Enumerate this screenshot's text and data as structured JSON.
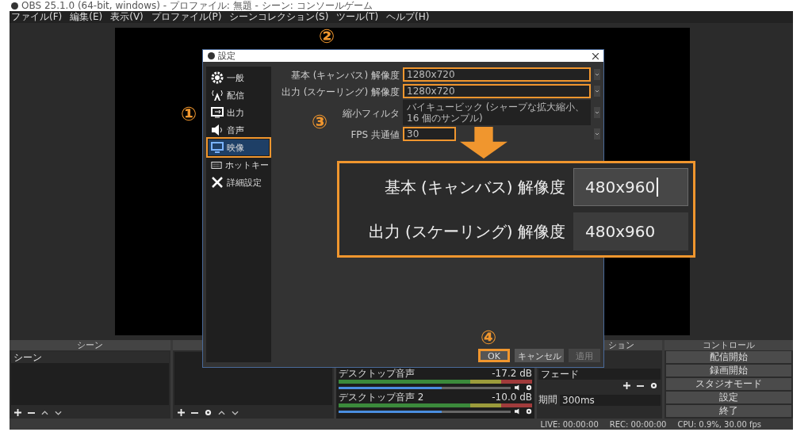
{
  "window": {
    "title": "OBS 25.1.0 (64-bit, windows) - プロファイル: 無題 - シーン: コンソールゲーム"
  },
  "menu": [
    "ファイル(F)",
    "編集(E)",
    "表示(V)",
    "プロファイル(P)",
    "シーンコレクション(S)",
    "ツール(T)",
    "ヘルプ(H)"
  ],
  "settings_dialog": {
    "title": "設定",
    "sidebar": [
      {
        "label": "一般",
        "selected": false,
        "highlighted": false
      },
      {
        "label": "配信",
        "selected": false,
        "highlighted": false
      },
      {
        "label": "出力",
        "selected": false,
        "highlighted": false
      },
      {
        "label": "音声",
        "selected": false,
        "highlighted": false
      },
      {
        "label": "映像",
        "selected": true,
        "highlighted": true
      },
      {
        "label": "ホットキー",
        "selected": false,
        "highlighted": false
      },
      {
        "label": "詳細設定",
        "selected": false,
        "highlighted": false
      }
    ],
    "fields": [
      {
        "label": "基本 (キャンバス) 解像度",
        "value": "1280x720",
        "highlighted": true
      },
      {
        "label": "出力 (スケーリング) 解像度",
        "value": "1280x720",
        "highlighted": true
      },
      {
        "label": "縮小フィルタ",
        "value": "バイキュービック (シャープな拡大縮小、16 個のサンプル)",
        "highlighted": false
      },
      {
        "label": "FPS 共通値",
        "value": "30",
        "highlighted": true
      }
    ],
    "buttons": [
      {
        "label": "OK",
        "highlighted": true,
        "disabled": false
      },
      {
        "label": "キャンセル",
        "highlighted": false,
        "disabled": false
      },
      {
        "label": "適用",
        "highlighted": false,
        "disabled": true
      }
    ]
  },
  "callout": {
    "rows": [
      {
        "label": "基本 (キャンバス) 解像度",
        "value": "480x960",
        "focused": true
      },
      {
        "label": "出力 (スケーリング) 解像度",
        "value": "480x960",
        "focused": false
      }
    ]
  },
  "step_markers": [
    "①",
    "②",
    "③",
    "④"
  ],
  "scenes": {
    "header": "シーン",
    "items": [
      "シーン"
    ]
  },
  "mixer": {
    "tracks": [
      {
        "name": "デスクトップ音声",
        "reading": "-17.2 dB",
        "level": 0.6
      },
      {
        "name": "デスクトップ音声 2",
        "reading": "-10.0 dB",
        "level": 0.6
      }
    ]
  },
  "transitions": {
    "header": "ション",
    "value": "フェード",
    "duration_label": "期間",
    "duration": "300ms"
  },
  "controls": {
    "header": "コントロール",
    "buttons": [
      "配信開始",
      "録画開始",
      "スタジオモード",
      "設定",
      "終了"
    ]
  },
  "status_bar": [
    "LIVE: 00:00:00",
    "REC: 00:00:00",
    "CPU: 0.9%, 30.00 fps"
  ]
}
